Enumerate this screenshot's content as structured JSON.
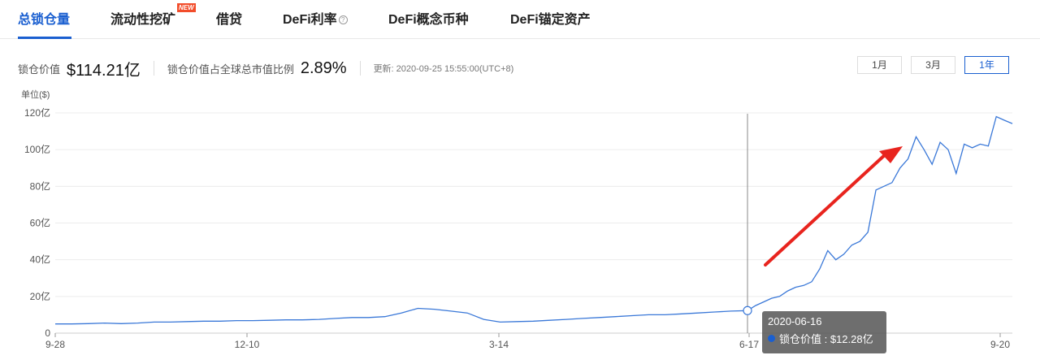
{
  "tabs": [
    {
      "label": "总锁仓量",
      "active": true
    },
    {
      "label": "流动性挖矿",
      "badge": "NEW"
    },
    {
      "label": "借贷"
    },
    {
      "label": "DeFi利率",
      "help": "?"
    },
    {
      "label": "DeFi概念币种"
    },
    {
      "label": "DeFi锚定资产"
    }
  ],
  "stats": {
    "tvl_label": "锁仓价值",
    "tvl_value": "$114.21亿",
    "ratio_label": "锁仓价值占全球总市值比例",
    "ratio_value": "2.89%",
    "updated": "更新: 2020-09-25 15:55:00(UTC+8)"
  },
  "range_buttons": [
    {
      "label": "1月"
    },
    {
      "label": "3月"
    },
    {
      "label": "1年",
      "active": true
    }
  ],
  "tooltip": {
    "date": "2020-06-16",
    "label": "锁仓价值 : $12.28亿"
  },
  "colors": {
    "accent": "#1a5fd0",
    "line": "#3a78d8",
    "arrow": "#e8241e"
  },
  "chart_data": {
    "type": "line",
    "ylabel": "单位($)",
    "y_ticks": [
      "0",
      "20亿",
      "40亿",
      "60亿",
      "80亿",
      "100亿",
      "120亿"
    ],
    "ylim": [
      0,
      120
    ],
    "x_ticks": [
      "9-28",
      "12-10",
      "3-14",
      "6-17",
      "9-20"
    ],
    "grid": true,
    "series": [
      {
        "values": [
          5,
          5,
          5.2,
          5.5,
          5.2,
          5.5,
          6,
          6,
          6.3,
          6.5,
          6.5,
          6.8,
          6.8,
          7,
          7.2,
          7.2,
          7.5,
          8,
          8.5,
          8.5,
          9,
          11,
          13.5,
          13,
          12,
          11,
          7.5,
          6,
          6.3,
          6.5,
          7,
          7.5,
          8,
          8.5,
          9,
          9.5,
          10,
          10,
          10.5,
          11,
          11.5,
          12,
          12.28,
          15,
          17,
          19,
          20,
          23,
          25,
          26,
          28,
          35,
          45,
          40,
          43,
          48,
          50,
          55,
          78,
          80,
          82,
          90,
          95,
          107,
          100,
          92,
          104,
          100,
          87,
          103,
          101,
          103,
          102,
          118,
          116,
          114.2
        ]
      }
    ]
  }
}
